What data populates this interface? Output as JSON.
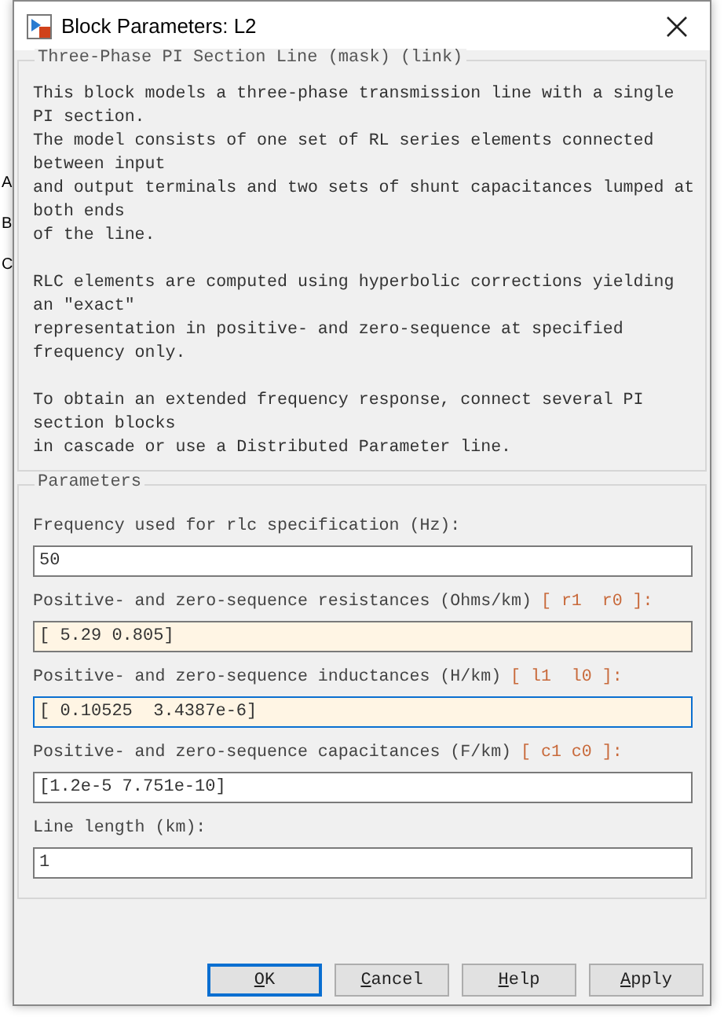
{
  "background": {
    "labels": [
      "A",
      "B",
      "C"
    ]
  },
  "window": {
    "title": "Block Parameters: L2"
  },
  "description": {
    "title": "Three-Phase PI Section Line (mask) (link)",
    "paragraphs": [
      [
        "This block models a three-phase transmission line with a single",
        "PI section.",
        "The model consists of one set of RL series elements connected",
        "between input",
        "and output terminals and two sets of shunt capacitances lumped at",
        "both ends",
        "of the line."
      ],
      [
        "RLC elements are computed using hyperbolic corrections yielding",
        "an ″exact″",
        "representation in positive- and zero-sequence at specified",
        "frequency only."
      ],
      [
        "To obtain an extended frequency response, connect several PI",
        "section blocks",
        "in cascade or use a Distributed Parameter line."
      ]
    ]
  },
  "parameters": {
    "title": "Parameters",
    "fields": [
      {
        "label": "Frequency used for rlc specification (Hz):",
        "value": "50",
        "modified": false,
        "focused": false
      },
      {
        "label": "Positive- and zero-sequence resistances (Ohms/km)",
        "hint": "[ r1  r0 ]:",
        "value": "[ 5.29 0.805]",
        "modified": true,
        "focused": false
      },
      {
        "label": "Positive- and zero-sequence inductances (H/km)",
        "hint": "[ l1  l0 ]:",
        "value": "[ 0.10525  3.4387e-6]",
        "modified": true,
        "focused": true
      },
      {
        "label": "Positive- and zero-sequence capacitances (F/km)",
        "hint": "[ c1 c0 ]:",
        "value": "[1.2e-5 7.751e-10]",
        "modified": false,
        "focused": false
      },
      {
        "label": "Line length (km):",
        "value": "1",
        "modified": false,
        "focused": false
      }
    ]
  },
  "buttons": [
    {
      "key": "O",
      "rest": "K",
      "default": true
    },
    {
      "key": "C",
      "rest": "ancel",
      "default": false
    },
    {
      "key": "H",
      "rest": "elp",
      "default": false
    },
    {
      "key": "A",
      "rest": "pply",
      "default": false
    }
  ]
}
